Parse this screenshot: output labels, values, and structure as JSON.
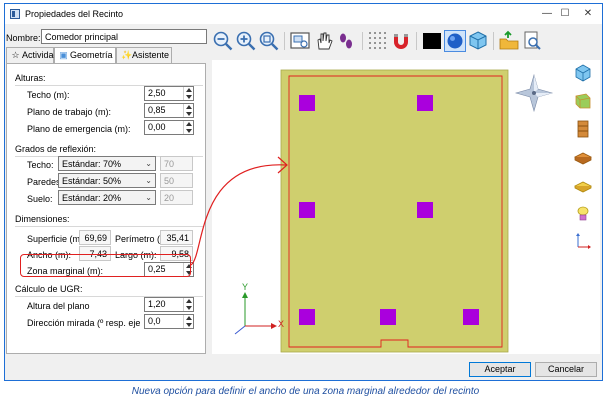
{
  "window": {
    "title": "Propiedades del Recinto"
  },
  "name": {
    "label": "Nombre:",
    "value": "Comedor principal"
  },
  "tabs": [
    {
      "label": "Actividad",
      "icon": "star-icon"
    },
    {
      "label": "Geometría",
      "icon": "cube-icon"
    },
    {
      "label": "Asistente",
      "icon": "wand-icon"
    }
  ],
  "alturas": {
    "title": "Alturas:",
    "techo": {
      "label": "Techo (m):",
      "value": "2,50"
    },
    "plano_trabajo": {
      "label": "Plano de trabajo (m):",
      "value": "0,85"
    },
    "plano_emergencia": {
      "label": "Plano de emergencia (m):",
      "value": "0,00"
    }
  },
  "reflexion": {
    "title": "Grados de reflexión:",
    "techo": {
      "label": "Techo:",
      "option": "Estándar: 70%",
      "value": "70"
    },
    "paredes": {
      "label": "Paredes:",
      "option": "Estándar: 50%",
      "value": "50"
    },
    "suelo": {
      "label": "Suelo:",
      "option": "Estándar: 20%",
      "value": "20"
    }
  },
  "dimensiones": {
    "title": "Dimensiones:",
    "superficie": {
      "label": "Superficie (m²):",
      "value": "69,69"
    },
    "perimetro": {
      "label": "Perímetro (m):",
      "value": "35,41"
    },
    "ancho": {
      "label": "Ancho (m):",
      "value": "7,43"
    },
    "largo": {
      "label": "Largo (m):",
      "value": "9,58"
    },
    "zona_marginal": {
      "label": "Zona marginal (m):",
      "value": "0,25"
    }
  },
  "ugr": {
    "title": "Cálculo de UGR:",
    "altura": {
      "label": "Altura del plano",
      "value": "1,20"
    },
    "direccion": {
      "label": "Dirección mirada (º resp. eje",
      "value": "0,0"
    }
  },
  "axes": {
    "x": "X",
    "y": "Y"
  },
  "buttons": {
    "accept": "Aceptar",
    "cancel": "Cancelar"
  },
  "caption": "Nueva opción para definir el ancho de una zona marginal alrededor del recinto",
  "colors": {
    "room": "#cfcf6e",
    "luminaire": "#aa00dd",
    "margin_line": "#e02020",
    "title_accent": "#1e6fd6",
    "caption": "#1f4fa0"
  },
  "toolbar_icons": [
    "zoom-out-icon",
    "zoom-in-icon",
    "zoom-fit-icon",
    "zoom-window-icon",
    "view-2d-icon",
    "hand-icon",
    "footprints-icon",
    "grid-icon",
    "magnet-icon",
    "black-square-icon",
    "sphere-icon",
    "cube-3d-icon",
    "export-icon",
    "print-preview-icon"
  ],
  "side_icons": [
    "view-cube-icon",
    "room-icon",
    "cabinet-icon",
    "table-icon",
    "floor-icon",
    "lamp-icon",
    "dimension-icon"
  ]
}
